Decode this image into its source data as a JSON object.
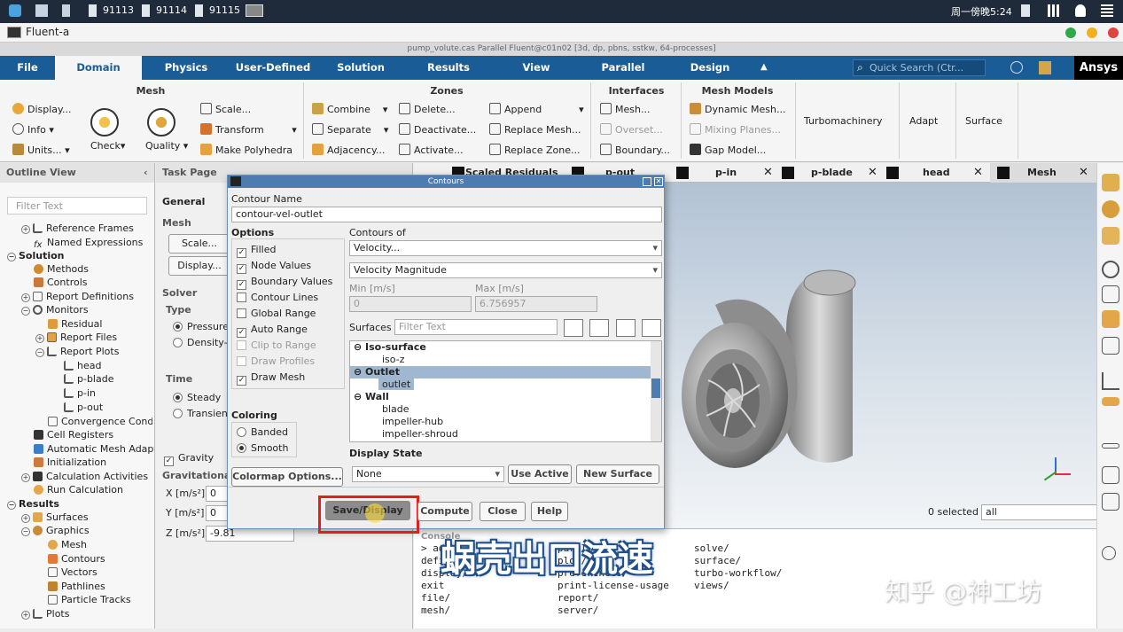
{
  "system_bar": {
    "tasks": [
      "91113",
      "91114",
      "91115"
    ],
    "clock": "周一傍晚5:24"
  },
  "app": {
    "title": "Fluent-a",
    "window_title": "pump_volute.cas Parallel Fluent@c01n02  [3d, dp, pbns, sstkw, 64-processes]"
  },
  "menu": {
    "items": [
      "File",
      "Domain",
      "Physics",
      "User-Defined",
      "Solution",
      "Results",
      "View",
      "Parallel",
      "Design"
    ],
    "active": "Domain",
    "quick_search_placeholder": "Quick Search (Ctr...",
    "brand": "Ansys"
  },
  "ribbon": {
    "mesh": {
      "title": "Mesh",
      "display": "Display...",
      "info": "Info",
      "units": "Units...",
      "check": "Check",
      "quality": "Quality",
      "scale": "Scale...",
      "transform": "Transform",
      "make_polyhedra": "Make Polyhedra"
    },
    "zones": {
      "title": "Zones",
      "combine": "Combine",
      "separate": "Separate",
      "adjacency": "Adjacency...",
      "delete": "Delete...",
      "deactivate": "Deactivate...",
      "activate": "Activate...",
      "append": "Append",
      "replace_mesh": "Replace Mesh...",
      "replace_zone": "Replace Zone..."
    },
    "interfaces": {
      "title": "Interfaces",
      "mesh": "Mesh...",
      "overset": "Overset...",
      "boundary": "Boundary..."
    },
    "mesh_models": {
      "title": "Mesh Models",
      "dynamic_mesh": "Dynamic Mesh...",
      "mixing_planes": "Mixing Planes...",
      "gap_model": "Gap Model..."
    },
    "turbomachinery": "Turbomachinery",
    "adapt": "Adapt",
    "surface": "Surface"
  },
  "outline": {
    "title": "Outline View",
    "filter_placeholder": "Filter Text",
    "items": [
      "Reference Frames",
      "Named Expressions",
      "Solution",
      "Methods",
      "Controls",
      "Report Definitions",
      "Monitors",
      "Residual",
      "Report Files",
      "Report Plots",
      "head",
      "p-blade",
      "p-in",
      "p-out",
      "Convergence Conditions",
      "Cell Registers",
      "Automatic Mesh Adaption",
      "Initialization",
      "Calculation Activities",
      "Run Calculation",
      "Results",
      "Surfaces",
      "Graphics",
      "Mesh",
      "Contours",
      "Vectors",
      "Pathlines",
      "Particle Tracks",
      "Plots"
    ]
  },
  "task_page": {
    "title": "Task Page",
    "general": "General",
    "mesh": "Mesh",
    "scale_btn": "Scale...",
    "display_btn": "Display...",
    "solver": "Solver",
    "type": "Type",
    "pressure": "Pressure",
    "density": "Density-",
    "time": "Time",
    "steady": "Steady",
    "transient": "Transient",
    "gravity": "Gravity",
    "gravitational": "Gravitational",
    "x_label": "X [m/s²]",
    "x_value": "0",
    "y_label": "Y [m/s²]",
    "y_value": "0",
    "z_label": "Z [m/s²]",
    "z_value": "-9.81"
  },
  "graphics_tabs": [
    "Scaled Residuals",
    "p-out",
    "p-in",
    "p-blade",
    "head",
    "Mesh"
  ],
  "graphics": {
    "selected": "0 selected",
    "filter": "all"
  },
  "contours_dialog": {
    "title": "Contours",
    "contour_name_label": "Contour Name",
    "contour_name": "contour-vel-outlet",
    "options_label": "Options",
    "options": [
      {
        "label": "Filled",
        "checked": true,
        "disabled": false
      },
      {
        "label": "Node Values",
        "checked": true,
        "disabled": false
      },
      {
        "label": "Boundary Values",
        "checked": true,
        "disabled": false
      },
      {
        "label": "Contour Lines",
        "checked": false,
        "disabled": false
      },
      {
        "label": "Global Range",
        "checked": false,
        "disabled": false
      },
      {
        "label": "Auto Range",
        "checked": true,
        "disabled": false
      },
      {
        "label": "Clip to Range",
        "checked": false,
        "disabled": true
      },
      {
        "label": "Draw Profiles",
        "checked": false,
        "disabled": true
      },
      {
        "label": "Draw Mesh",
        "checked": true,
        "disabled": false
      }
    ],
    "coloring_label": "Coloring",
    "banded": "Banded",
    "smooth": "Smooth",
    "colormap_btn": "Colormap Options...",
    "contours_of_label": "Contours of",
    "contours_of": "Velocity...",
    "variable": "Velocity Magnitude",
    "min_label": "Min [m/s]",
    "min_value": "0",
    "max_label": "Max [m/s]",
    "max_value": "6.756957",
    "surfaces_label": "Surfaces",
    "surfaces_filter_placeholder": "Filter Text",
    "surface_list": [
      {
        "text": "Iso-surface",
        "group": true,
        "selected": false
      },
      {
        "text": "iso-z",
        "group": false,
        "selected": false
      },
      {
        "text": "Outlet",
        "group": true,
        "selected": true
      },
      {
        "text": "outlet",
        "group": false,
        "selected": true
      },
      {
        "text": "Wall",
        "group": true,
        "selected": false
      },
      {
        "text": "blade",
        "group": false,
        "selected": false
      },
      {
        "text": "impeller-hub",
        "group": false,
        "selected": false
      },
      {
        "text": "impeller-shroud",
        "group": false,
        "selected": false
      }
    ],
    "display_state_label": "Display State",
    "display_state": "None",
    "use_active_btn": "Use Active",
    "new_surface_btn": "New Surface",
    "save_display_btn": "Save/Display",
    "compute_btn": "Compute",
    "close_btn": "Close",
    "help_btn": "Help"
  },
  "console": {
    "title": "Console",
    "col1": [
      "> ad",
      "define/",
      "display/",
      "exit",
      "file/",
      "mesh/"
    ],
    "col2": [
      "parallel/",
      "plot/",
      "preferences/",
      "print-license-usage",
      "report/",
      "server/"
    ],
    "col3": [
      "solve/",
      "surface/",
      "turbo-workflow/",
      "views/"
    ]
  },
  "overlay": {
    "subtitle": "蜗壳出口流速",
    "watermark": "知乎 @神工坊"
  }
}
